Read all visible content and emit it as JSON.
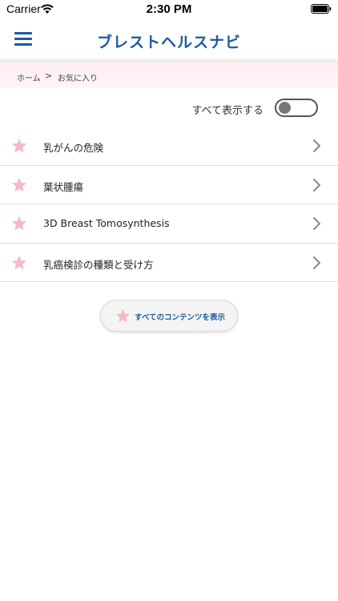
{
  "status_bar": {
    "carrier": "Carrier",
    "time": "2:30 PM"
  },
  "header": {
    "title": "ブレストヘルスナビ",
    "menu_icon": "hamburger-menu-icon",
    "accent_color": "#1d5a9c"
  },
  "breadcrumb": {
    "home": "ホーム",
    "separator": ">",
    "current": "お気に入り"
  },
  "toggle": {
    "label": "すべて表示する",
    "state": "off"
  },
  "favorites": [
    {
      "label": "乳がんの危険",
      "icon": "star-icon"
    },
    {
      "label": "葉状腫瘍",
      "icon": "star-icon"
    },
    {
      "label": "3D Breast Tomosynthesis",
      "icon": "star-icon"
    },
    {
      "label": "乳癌検診の種類と受け方",
      "icon": "star-icon"
    }
  ],
  "all_contents_button": {
    "label": "すべてのコンテンツを表示",
    "icon": "star-icon"
  },
  "colors": {
    "star": "#f5b9c2",
    "breadcrumb_bg": "#fdeef0"
  }
}
